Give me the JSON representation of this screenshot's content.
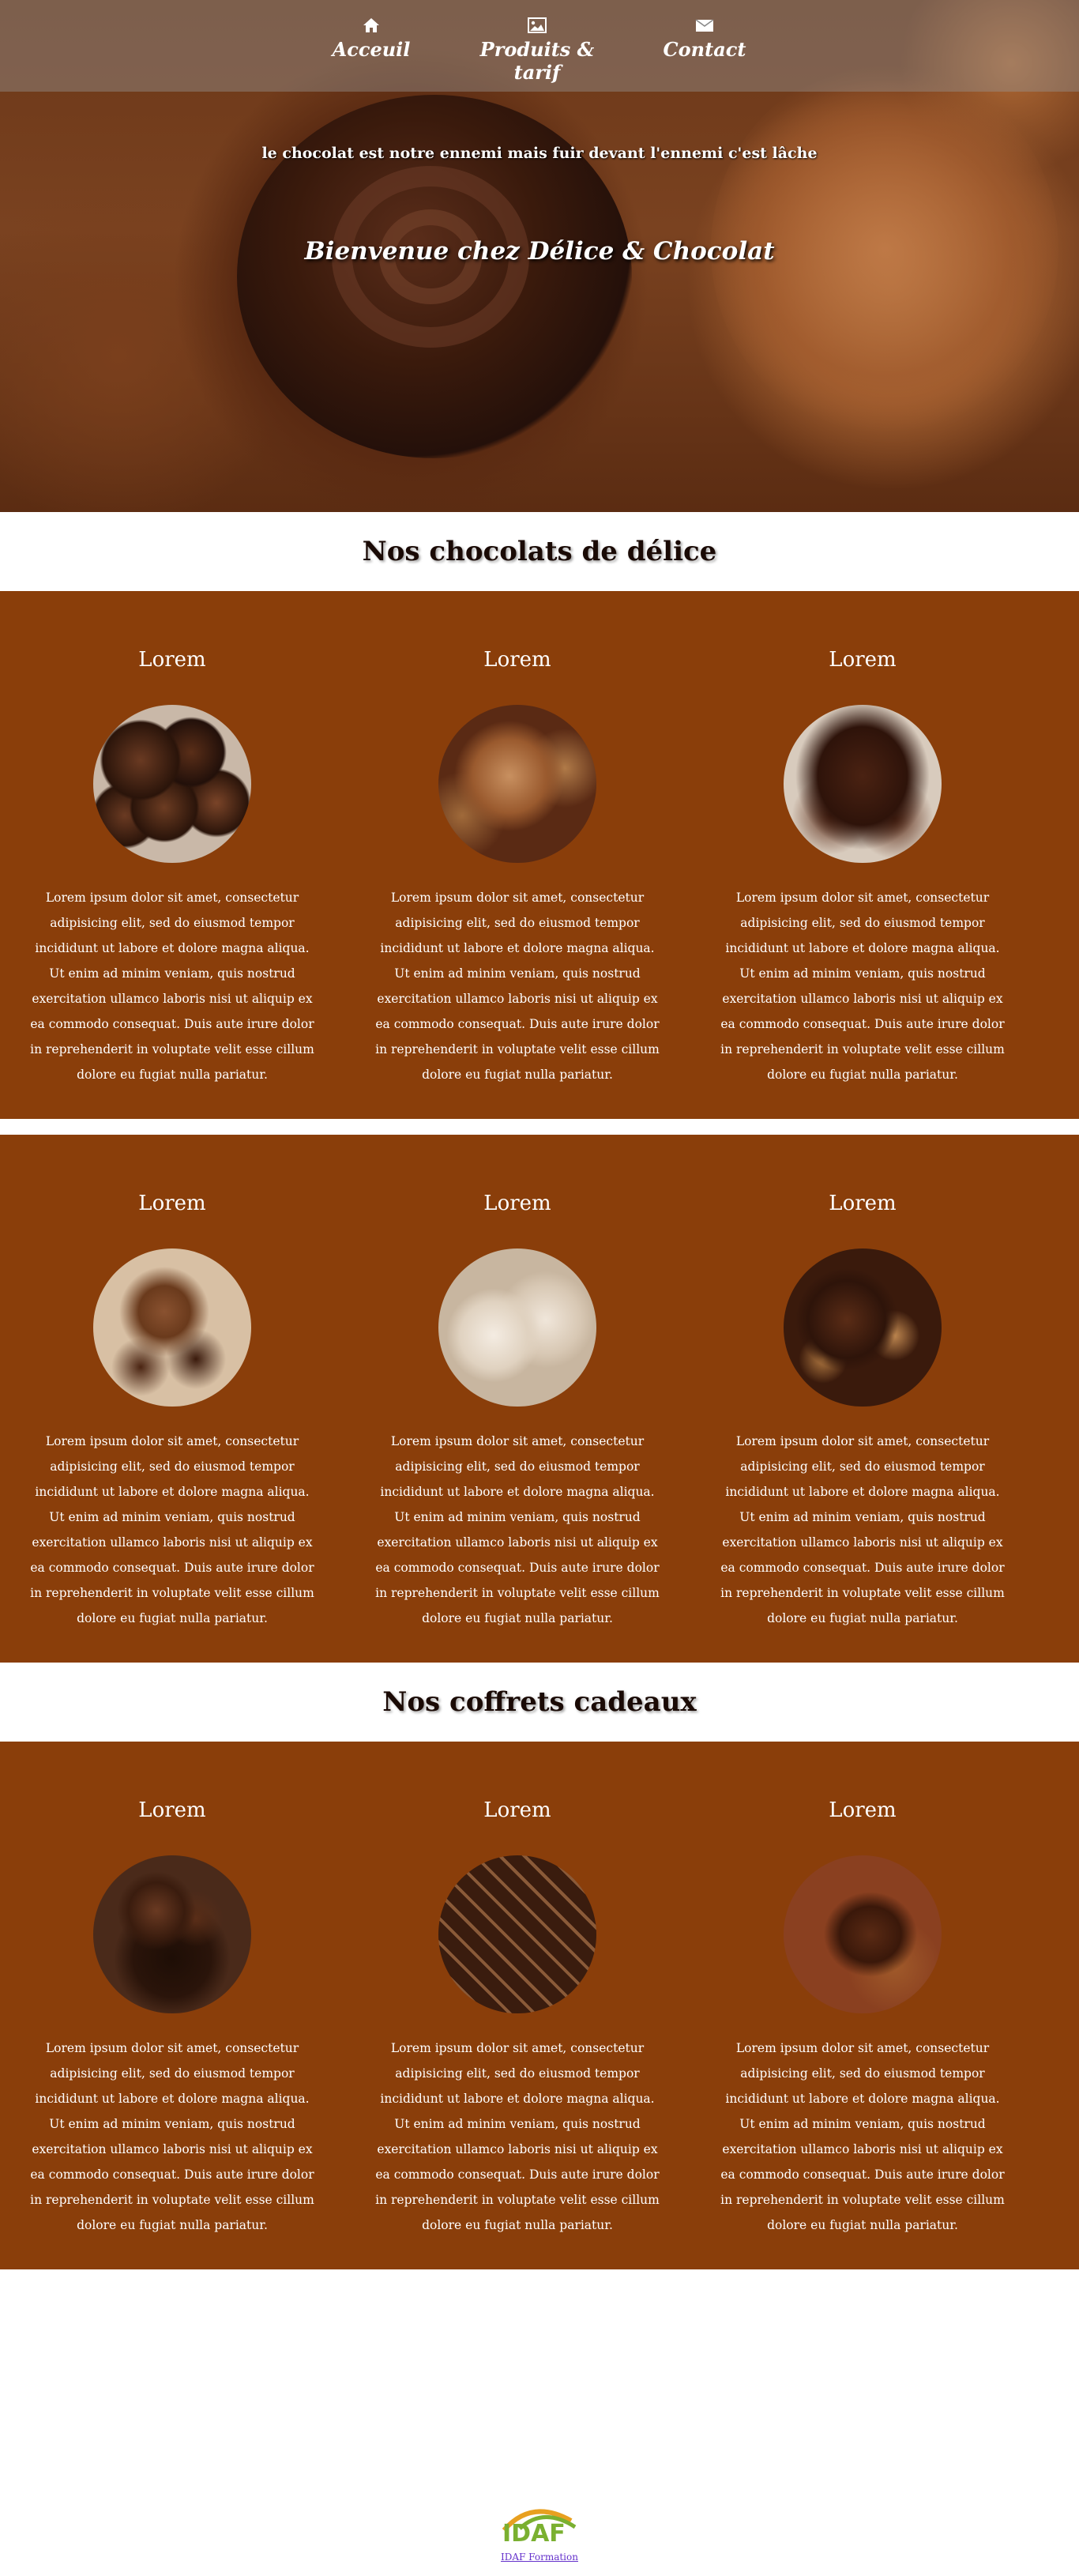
{
  "nav": {
    "items": [
      {
        "label": "Acceuil",
        "icon": "home-icon"
      },
      {
        "label": "Produits & tarif",
        "icon": "image-icon"
      },
      {
        "label": "Contact",
        "icon": "envelope-icon"
      }
    ]
  },
  "hero": {
    "tagline": "le chocolat est notre ennemi mais fuir devant l'ennemi c'est lâche",
    "welcome": "Bienvenue chez Délice & Chocolat"
  },
  "sections": {
    "chocolates_title": "Nos chocolats de délice",
    "gifts_title": "Nos coffrets cadeaux"
  },
  "card_text": "Lorem ipsum dolor sit amet, consectetur adipisicing elit, sed do eiusmod tempor incididunt ut labore et dolore magna aliqua. Ut enim ad minim veniam, quis nostrud exercitation ullamco laboris nisi ut aliquip ex ea commodo consequat. Duis aute irure dolor in reprehenderit in voluptate velit esse cillum dolore eu fugiat nulla pariatur.",
  "cards": [
    {
      "title": "Lorem",
      "image": "assorted-truffles-image"
    },
    {
      "title": "Lorem",
      "image": "hazelnut-pralines-image"
    },
    {
      "title": "Lorem",
      "image": "chocolate-shells-image"
    },
    {
      "title": "Lorem",
      "image": "nut-chocolates-image"
    },
    {
      "title": "Lorem",
      "image": "coconut-balls-image"
    },
    {
      "title": "Lorem",
      "image": "almond-chocolates-image"
    },
    {
      "title": "Lorem",
      "image": "gift-box-truffles-image"
    },
    {
      "title": "Lorem",
      "image": "gift-box-assortment-image"
    },
    {
      "title": "Lorem",
      "image": "cocoa-spoon-image"
    }
  ],
  "footer": {
    "logo_text": "IDAF",
    "link": "IDAF Formation"
  },
  "colors": {
    "band": "#8a3e0a",
    "title_text": "#1a0a05"
  }
}
